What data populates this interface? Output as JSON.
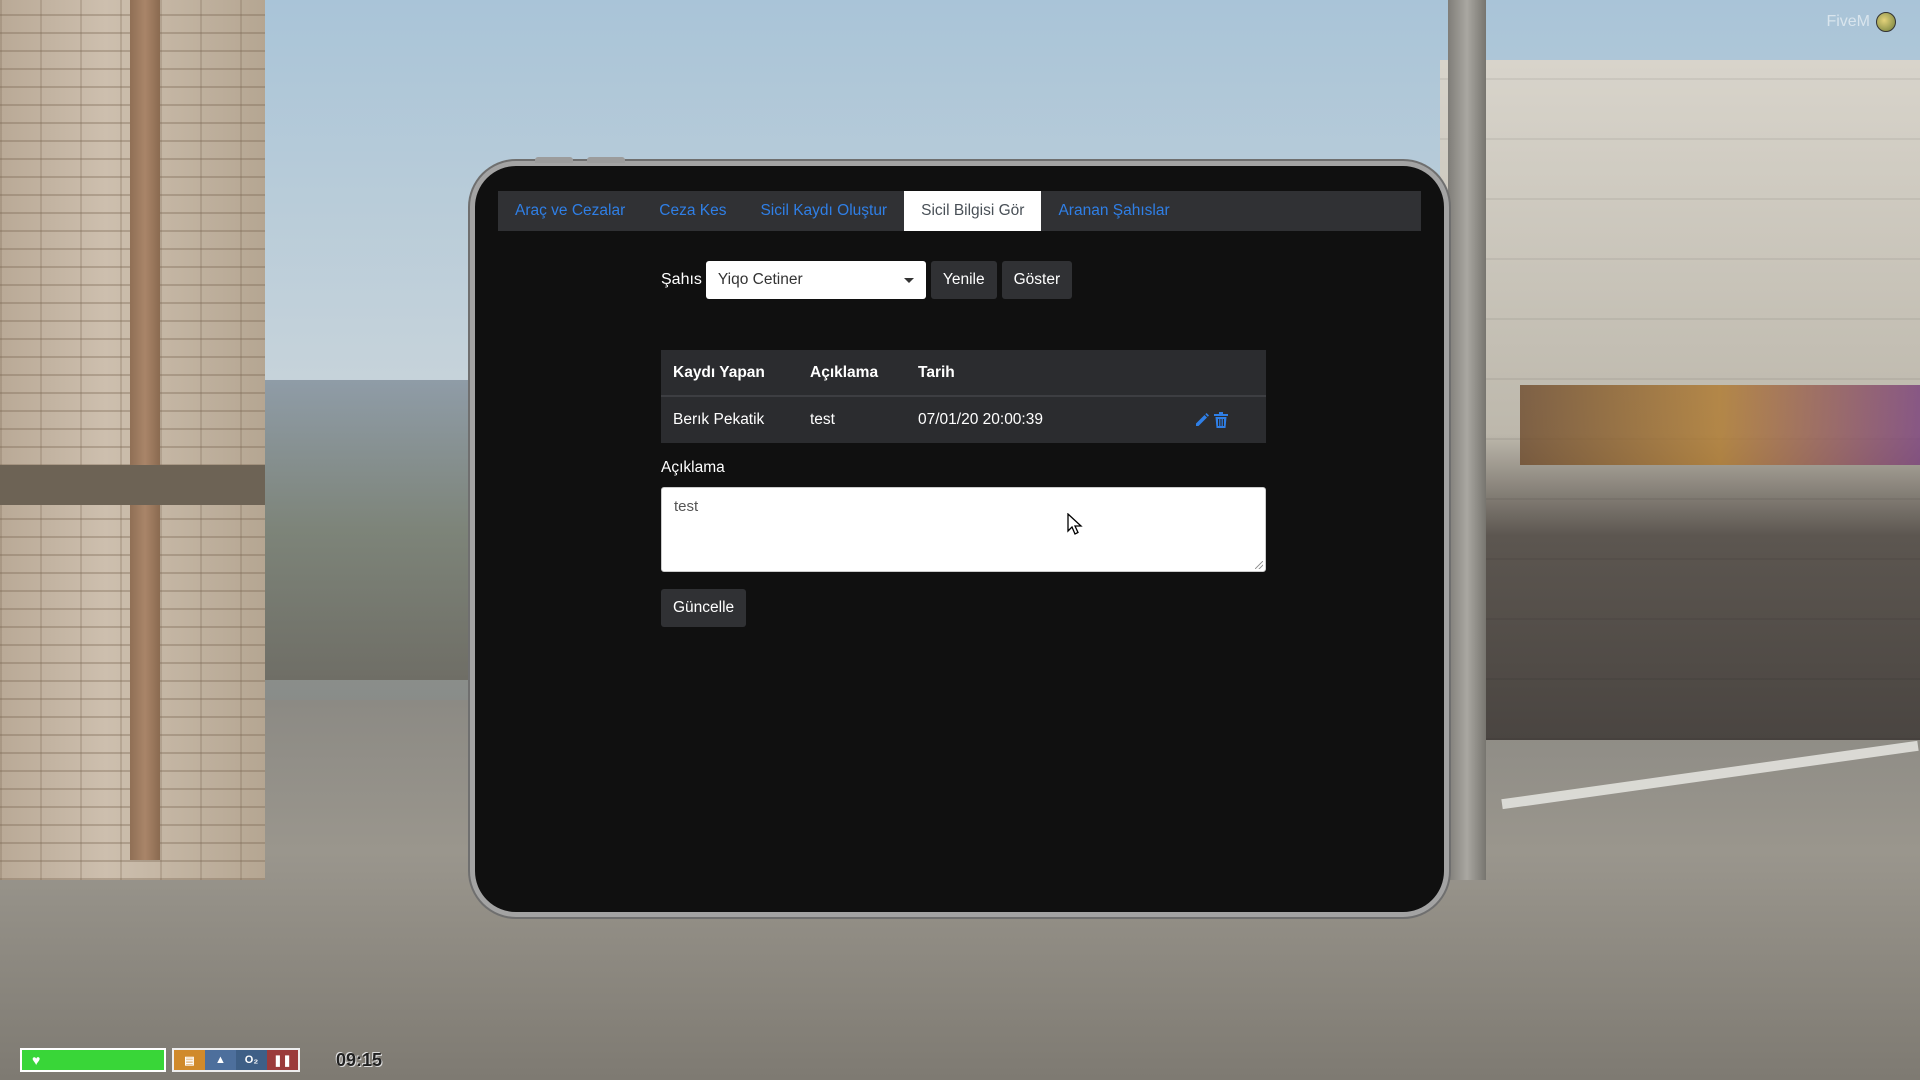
{
  "overlay": {
    "brand": "FiveM"
  },
  "tablet": {
    "tabs": [
      {
        "label": "Araç ve Cezalar",
        "active": false
      },
      {
        "label": "Ceza Kes",
        "active": false
      },
      {
        "label": "Sicil Kaydı Oluştur",
        "active": false
      },
      {
        "label": "Sicil Bilgisi Gör",
        "active": true
      },
      {
        "label": "Aranan Şahıslar",
        "active": false
      }
    ],
    "filter": {
      "label": "Şahıs",
      "selected": "Yiqo Cetiner",
      "refresh_label": "Yenile",
      "show_label": "Göster"
    },
    "table": {
      "headers": [
        "Kaydı Yapan",
        "Açıklama",
        "Tarih"
      ],
      "rows": [
        {
          "recorder": "Berık Pekatik",
          "description": "test",
          "date": "07/01/20 20:00:39"
        }
      ]
    },
    "editor": {
      "label": "Açıklama",
      "value": "test",
      "update_label": "Güncelle"
    },
    "colors": {
      "accent": "#2f7fe6",
      "panel": "#303134",
      "background": "#101010"
    }
  },
  "hud": {
    "clock": "09:15",
    "health_color": "#39d638",
    "status_icons": [
      "armor-icon",
      "water-icon",
      "oxygen-icon",
      "lungs-icon"
    ]
  }
}
